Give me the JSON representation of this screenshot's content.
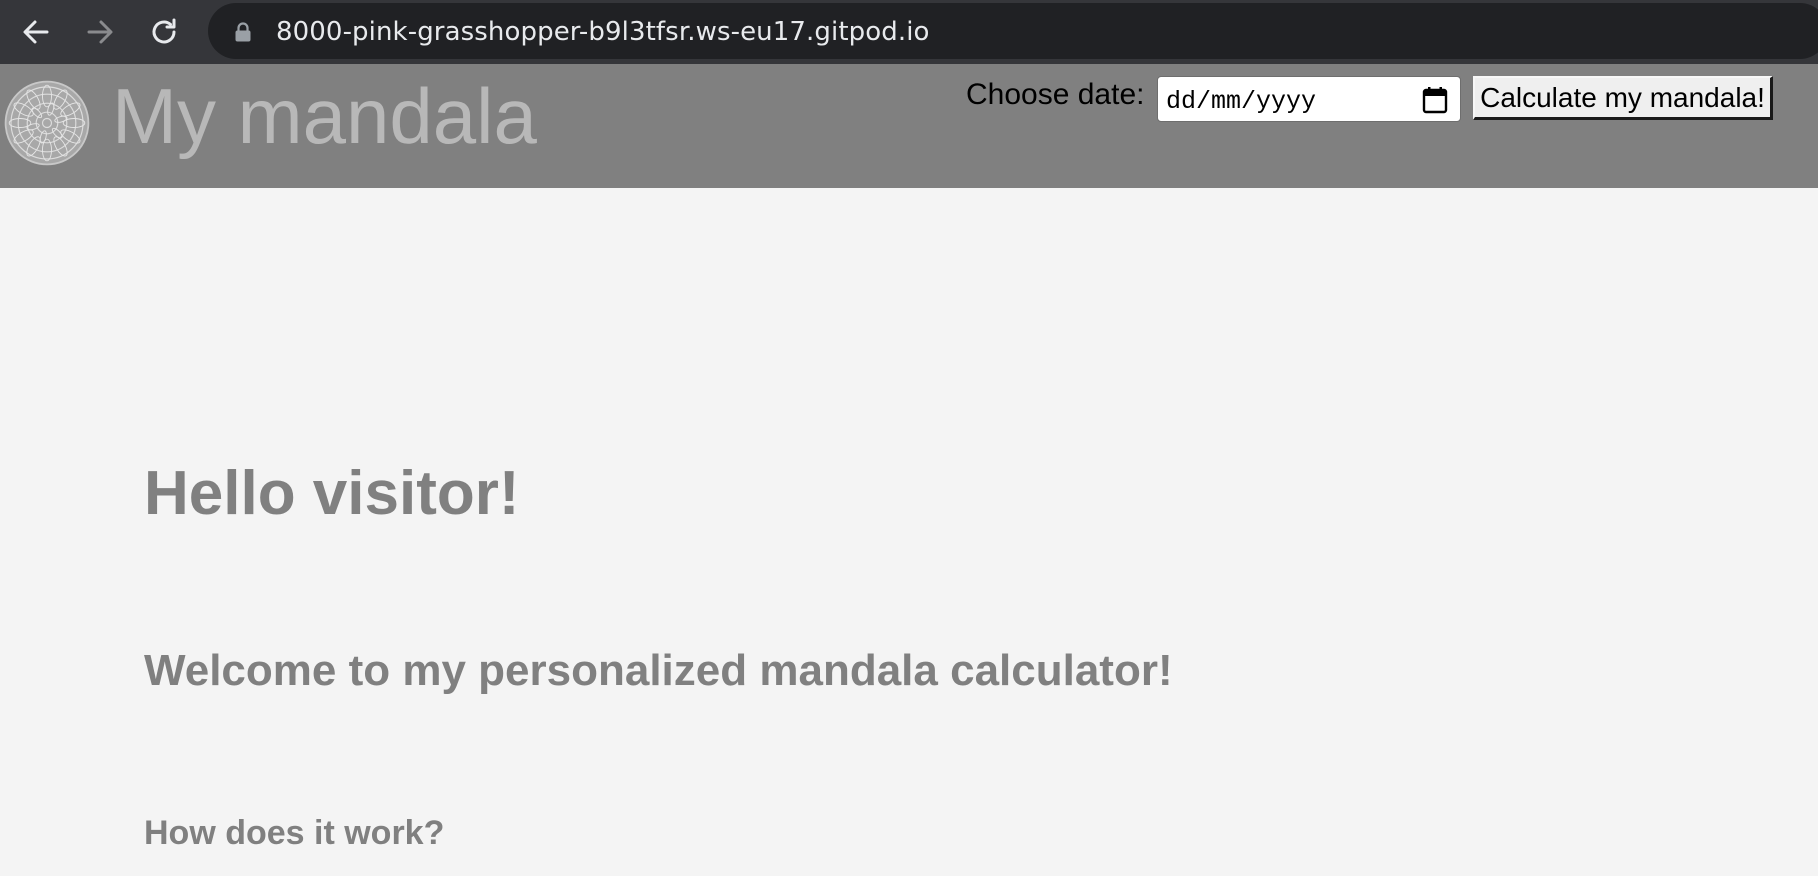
{
  "browser": {
    "url": "8000-pink-grasshopper-b9l3tfsr.ws-eu17.gitpod.io",
    "icons": {
      "back": "arrow-left-icon",
      "forward": "arrow-right-icon",
      "reload": "reload-icon",
      "lock": "lock-icon"
    },
    "colors": {
      "toolbar": "#35363a",
      "address_bar": "#202124",
      "url_text": "#e8eaed"
    }
  },
  "header": {
    "title": "My mandala",
    "logo_icon": "mandala-icon",
    "date_label": "Choose date:",
    "date_input": {
      "placeholder": "dd/mm/yyyy",
      "value": ""
    },
    "calculate_button": "Calculate my mandala!",
    "colors": {
      "background": "#808080",
      "title": "#b8b8b8"
    }
  },
  "main": {
    "greeting": "Hello visitor!",
    "welcome": "Welcome to my personalized mandala calculator!",
    "how_heading": "How does it work?",
    "colors": {
      "background": "#f4f4f4",
      "text": "#808080"
    }
  }
}
